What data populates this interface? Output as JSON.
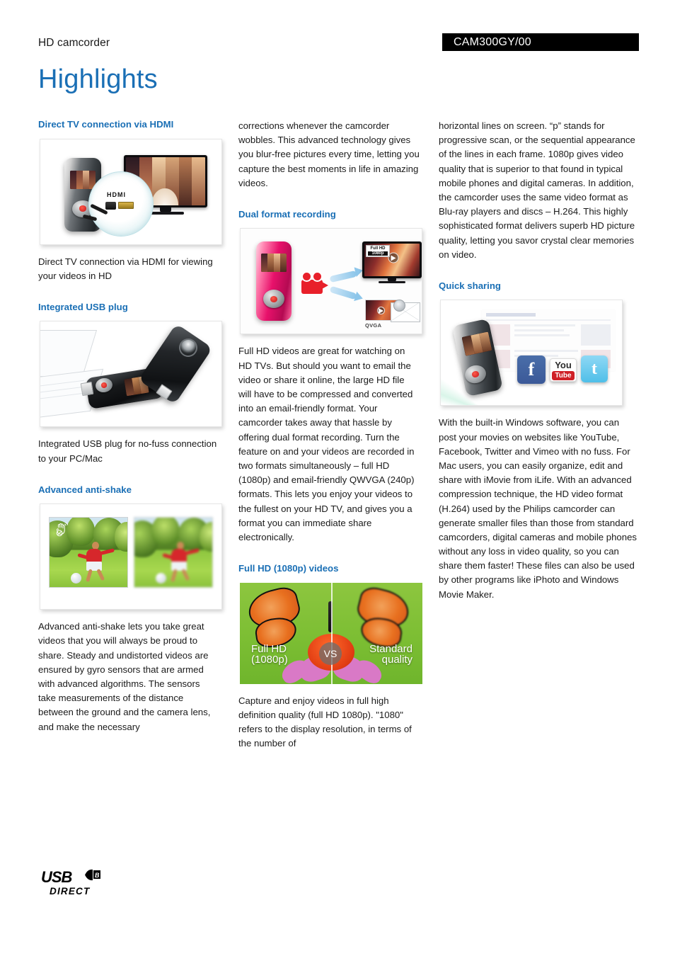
{
  "header": {
    "product_category": "HD camcorder",
    "product_code": "CAM300GY/00"
  },
  "page_title": "Highlights",
  "colors": {
    "accent_blue": "#1a6fb5",
    "code_bar_bg": "#000000",
    "body_text": "#1a1a1a"
  },
  "columns": [
    {
      "blocks": [
        {
          "type": "feature",
          "heading": "Direct TV connection via HDMI",
          "figure": "hdmi-tv-connection-image",
          "figure_labels": [
            "HDMI"
          ],
          "caption": "Direct TV connection via HDMI for viewing your videos in HD"
        },
        {
          "type": "feature",
          "heading": "Integrated USB plug",
          "figure": "usb-plug-laptop-image",
          "figure_labels": [],
          "caption": "Integrated USB plug for no-fuss connection to your PC/Mac"
        },
        {
          "type": "feature",
          "heading": "Advanced anti-shake",
          "figure": "anti-shake-comparison-image",
          "figure_labels": [],
          "caption": "Advanced anti-shake lets you take great videos that you will always be proud to share. Steady and undistorted videos are ensured by gyro sensors that are armed with advanced algorithms. The sensors take measurements of the distance between the ground and the camera lens, and make the necessary"
        }
      ]
    },
    {
      "blocks": [
        {
          "type": "continuation",
          "text": "corrections whenever the camcorder wobbles. This advanced technology gives you blur-free pictures every time, letting you capture the best moments in life in amazing videos."
        },
        {
          "type": "feature",
          "heading": "Dual format recording",
          "figure": "dual-format-recording-image",
          "figure_labels": [
            "Full HD",
            "1080p",
            "QVGA"
          ],
          "caption": "Full HD videos are great for watching on HD TVs. But should you want to email the video or share it online, the large HD file will have to be compressed and converted into an email-friendly format. Your camcorder takes away that hassle by offering dual format recording. Turn the feature on and your videos are recorded in two formats simultaneously – full HD (1080p) and email-friendly QWVGA (240p) formats. This lets you enjoy your videos to the fullest on your HD TV, and gives you a format you can immediate share electronically."
        },
        {
          "type": "feature",
          "heading": "Full HD (1080p) videos",
          "figure": "full-hd-butterfly-comparison-image",
          "figure_labels": [
            "Full HD",
            "(1080p)",
            "VS",
            "Standard",
            "quality"
          ],
          "caption": "Capture and enjoy videos in full high definition quality (full HD 1080p). \"1080\" refers to the display resolution, in terms of the number of"
        }
      ]
    },
    {
      "blocks": [
        {
          "type": "continuation",
          "text": "horizontal lines on screen. “p” stands for progressive scan, or the sequential appearance of the lines in each frame. 1080p gives video quality that is superior to that found in typical mobile phones and digital cameras. In addition, the camcorder uses the same video format as Blu-ray players and discs – H.264. This highly sophisticated format delivers superb HD picture quality, letting you savor crystal clear memories on video."
        },
        {
          "type": "feature",
          "heading": "Quick sharing",
          "figure": "quick-sharing-social-image",
          "figure_labels": [
            "f",
            "You",
            "Tube",
            "t"
          ],
          "caption": "With the built-in Windows software, you can post your movies on websites like YouTube, Facebook, Twitter and Vimeo with no fuss. For Mac users, you can easily organize, edit and share with iMovie from iLife. With an advanced compression technique, the HD video format (H.264) used by the Philips camcorder can generate smaller files than those from standard camcorders, digital cameras and mobile phones without any loss in video quality, so you can share them faster! These files can also be used by other programs like iPhoto and Windows Movie Maker."
        }
      ]
    }
  ],
  "footer": {
    "usb_logo_word": "USB",
    "usb_logo_sub": "DIRECT"
  },
  "figure_text": {
    "hdmi": "HDMI",
    "fullhd_top": "Full HD",
    "fullhd_bottom": "1080p",
    "qvga": "QVGA",
    "bfly_left_l1": "Full HD",
    "bfly_left_l2": "(1080p)",
    "bfly_vs": "VS",
    "bfly_right_l1": "Standard",
    "bfly_right_l2": "quality",
    "fb": "f",
    "yt_top": "You",
    "yt_bottom": "Tube",
    "tw": "t"
  }
}
